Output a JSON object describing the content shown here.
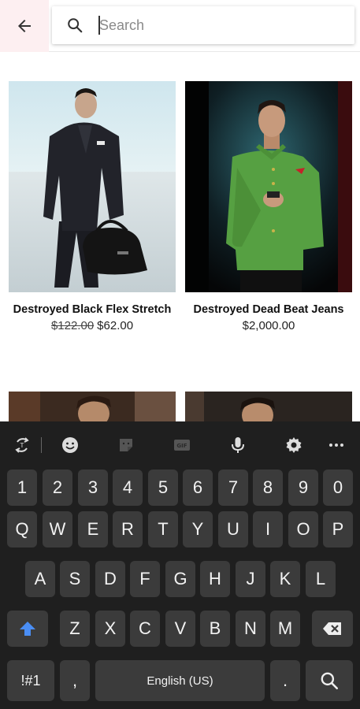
{
  "header": {
    "back_icon": "arrow-left-icon",
    "search": {
      "placeholder": "Search",
      "icon": "search-icon"
    }
  },
  "products": [
    {
      "name": "Destroyed Black Flex Stretch",
      "old_price": "$122.00",
      "price": "$62.00"
    },
    {
      "name": "Destroyed Dead Beat Jeans",
      "old_price": "",
      "price": "$2,000.00"
    }
  ],
  "keyboard": {
    "toolbar": [
      "translate-icon",
      "emoji-icon",
      "sticker-icon",
      "gif-icon",
      "microphone-icon",
      "settings-icon",
      "more-icon"
    ],
    "number_row": [
      "1",
      "2",
      "3",
      "4",
      "5",
      "6",
      "7",
      "8",
      "9",
      "0"
    ],
    "row1": [
      "Q",
      "W",
      "E",
      "R",
      "T",
      "Y",
      "U",
      "I",
      "O",
      "P"
    ],
    "row2": [
      "A",
      "S",
      "D",
      "F",
      "G",
      "H",
      "J",
      "K",
      "L"
    ],
    "row3": [
      "Z",
      "X",
      "C",
      "V",
      "B",
      "N",
      "M"
    ],
    "symbols_label": "!#1",
    "comma": ",",
    "space_label": "English (US)",
    "period": ".",
    "accent_color": "#4a8ef5"
  }
}
